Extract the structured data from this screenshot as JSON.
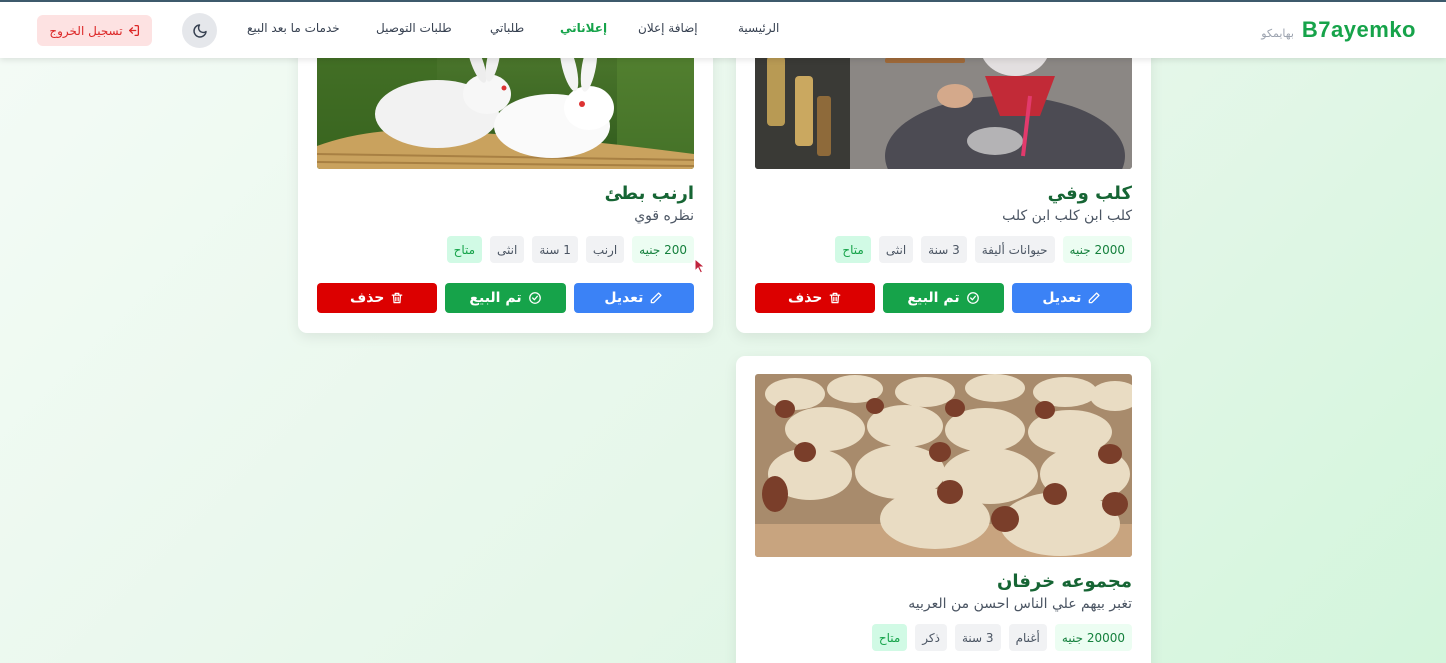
{
  "brand": {
    "name": "B7ayemko",
    "tagline": "بهايمكو"
  },
  "nav": {
    "home": "الرئيسية",
    "add_ad": "إضافة إعلان",
    "my_ads": "إعلاناتي",
    "my_requests": "طلباتي",
    "delivery_requests": "طلبات التوصيل",
    "after_sale": "خدمات ما بعد البيع",
    "logout": "تسجيل الخروج",
    "theme_icon": "moon-icon",
    "logout_icon": "sign-out-icon"
  },
  "colors": {
    "accent": "#16a34a",
    "edit": "#3b82f6",
    "sold": "#16a34a",
    "delete": "#dc0000"
  },
  "actions": {
    "edit": "تعديل",
    "sold": "تم البيع",
    "delete": "حذف"
  },
  "ads": [
    {
      "title": "ارنب بطئ",
      "description": "نظره قوي",
      "price": "200 جنيه",
      "type": "ارنب",
      "age": "1 سنة",
      "gender": "انثى",
      "status": "متاح"
    },
    {
      "title": "كلب وفي",
      "description": "كلب ابن كلب ابن كلب",
      "price": "2000 جنيه",
      "category": "حيوانات أليفة",
      "age": "3 سنة",
      "gender": "انثى",
      "status": "متاح"
    },
    {
      "title": "مجموعه خرفان",
      "description": "تغبر بيهم علي الناس احسن من العربيه",
      "price": "20000 جنيه",
      "category": "أغنام",
      "age": "3 سنة",
      "gender": "ذكر",
      "status": "متاح"
    }
  ]
}
